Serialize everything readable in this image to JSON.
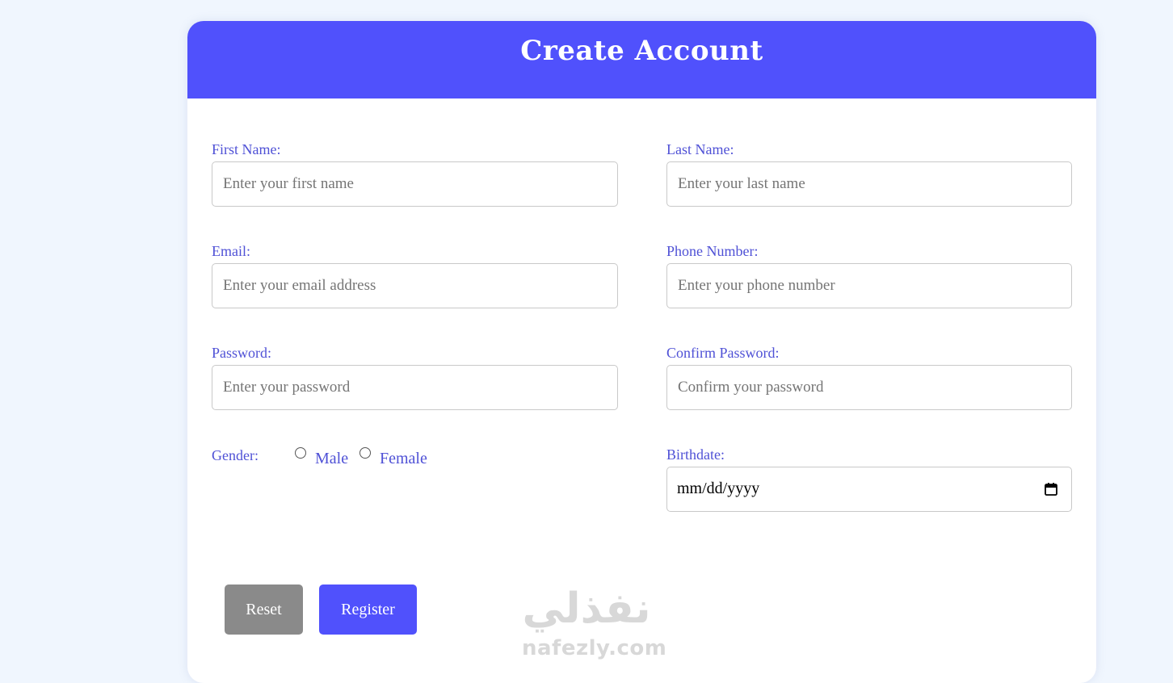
{
  "header": {
    "title": "Create Account"
  },
  "form": {
    "first_name": {
      "label": "First Name:",
      "placeholder": "Enter your first name",
      "value": ""
    },
    "last_name": {
      "label": "Last Name:",
      "placeholder": "Enter your last name",
      "value": ""
    },
    "email": {
      "label": "Email:",
      "placeholder": "Enter your email address",
      "value": ""
    },
    "phone": {
      "label": "Phone Number:",
      "placeholder": "Enter your phone number",
      "value": ""
    },
    "password": {
      "label": "Password:",
      "placeholder": "Enter your password",
      "value": ""
    },
    "confirm_password": {
      "label": "Confirm Password:",
      "placeholder": "Confirm your password",
      "value": ""
    },
    "gender": {
      "label": "Gender:",
      "options": [
        "Male",
        "Female"
      ],
      "selected": null
    },
    "birthdate": {
      "label": "Birthdate:",
      "display": "mm/dd/yyyy",
      "icon": "calendar-icon"
    }
  },
  "buttons": {
    "reset_label": "Reset",
    "register_label": "Register"
  },
  "watermark": {
    "arabic": "نفذلي",
    "latin": "nafezly.com"
  },
  "colors": {
    "accent": "#5051fc",
    "label": "#4f51d6",
    "reset": "#8a8a8a",
    "page_background": "#f0f6fe"
  }
}
